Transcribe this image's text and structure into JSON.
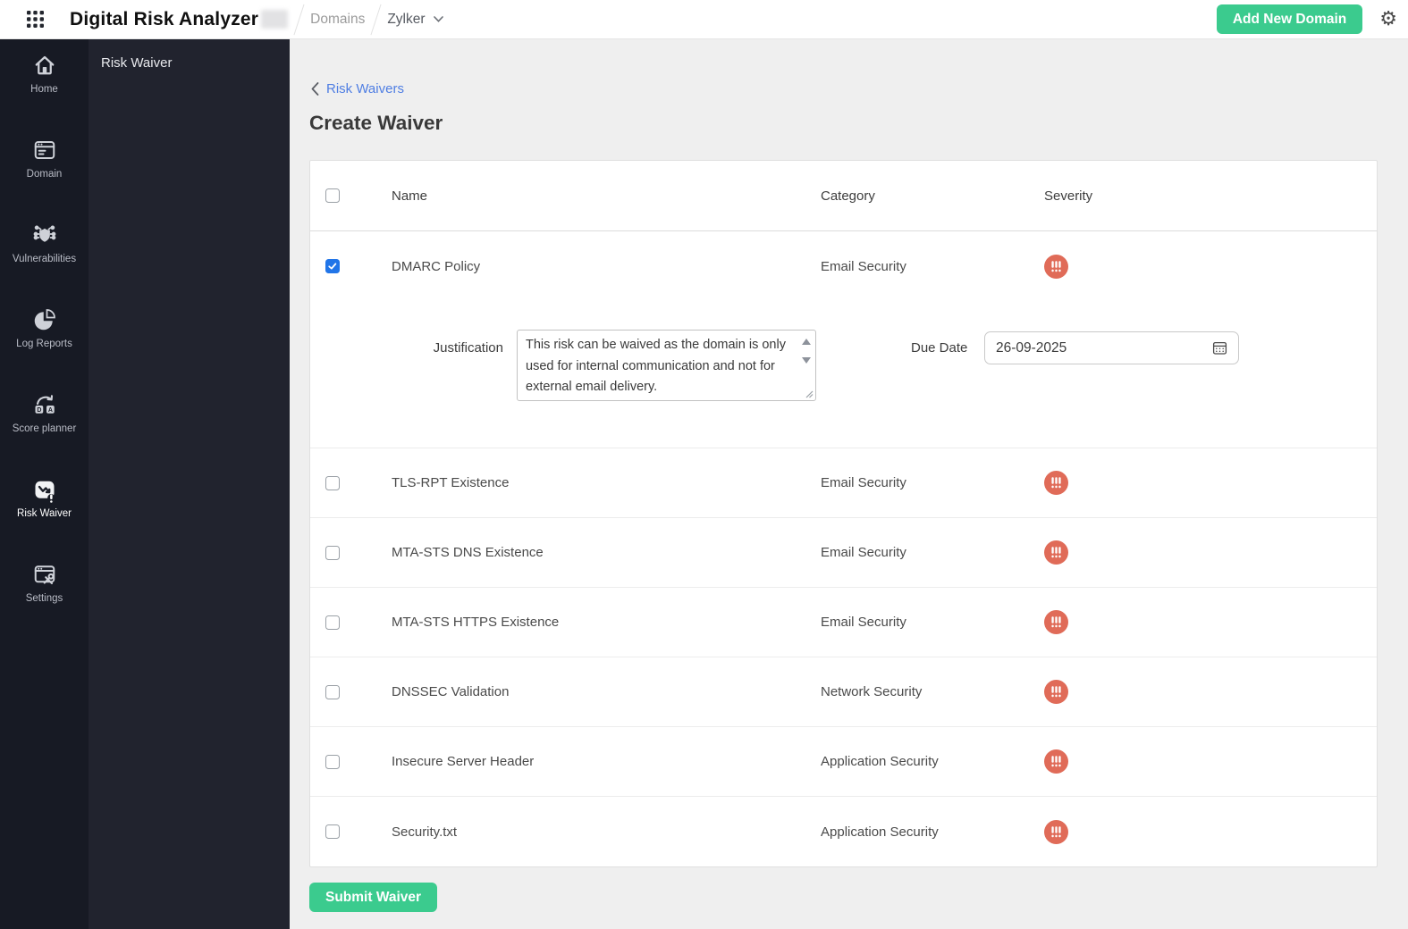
{
  "header": {
    "app_title": "Digital Risk Analyzer",
    "breadcrumb_section": "Domains",
    "breadcrumb_domain": "Zylker",
    "add_domain_label": "Add New Domain"
  },
  "sidebar": {
    "items": [
      {
        "label": "Home",
        "icon": "home-icon",
        "active": false
      },
      {
        "label": "Domain",
        "icon": "domain-icon",
        "active": false
      },
      {
        "label": "Vulnerabilities",
        "icon": "vulnerabilities-icon",
        "active": false
      },
      {
        "label": "Log Reports",
        "icon": "log-reports-icon",
        "active": false
      },
      {
        "label": "Score planner",
        "icon": "score-planner-icon",
        "active": false
      },
      {
        "label": "Risk Waiver",
        "icon": "risk-waiver-icon",
        "active": true
      },
      {
        "label": "Settings",
        "icon": "settings-icon",
        "active": false
      }
    ]
  },
  "panel": {
    "title": "Risk Waiver"
  },
  "main": {
    "back_link_label": "Risk Waivers",
    "page_title": "Create Waiver",
    "table": {
      "columns": {
        "name": "Name",
        "category": "Category",
        "severity": "Severity"
      },
      "rows": [
        {
          "name": "DMARC Policy",
          "category": "Email Security",
          "severity": "high",
          "checked": true
        },
        {
          "name": "TLS-RPT Existence",
          "category": "Email Security",
          "severity": "high",
          "checked": false
        },
        {
          "name": "MTA-STS DNS Existence",
          "category": "Email Security",
          "severity": "high",
          "checked": false
        },
        {
          "name": "MTA-STS HTTPS Existence",
          "category": "Email Security",
          "severity": "high",
          "checked": false
        },
        {
          "name": "DNSSEC Validation",
          "category": "Network Security",
          "severity": "high",
          "checked": false
        },
        {
          "name": "Insecure Server Header",
          "category": "Application Security",
          "severity": "high",
          "checked": false
        },
        {
          "name": "Security.txt",
          "category": "Application Security",
          "severity": "high",
          "checked": false
        }
      ]
    },
    "form": {
      "justification_label": "Justification",
      "justification_value": "This risk can be waived as the domain is only used for internal communication and not for external email delivery.",
      "due_date_label": "Due Date",
      "due_date_value": "26-09-2025"
    },
    "submit_label": "Submit Waiver"
  },
  "colors": {
    "accent_green": "#3bcb8e",
    "link_blue": "#4f7ee3",
    "severity_high": "#e06b58",
    "checkbox_checked": "#2175e8",
    "sidebar_bg": "#171a24",
    "panel_bg": "#21232e"
  }
}
